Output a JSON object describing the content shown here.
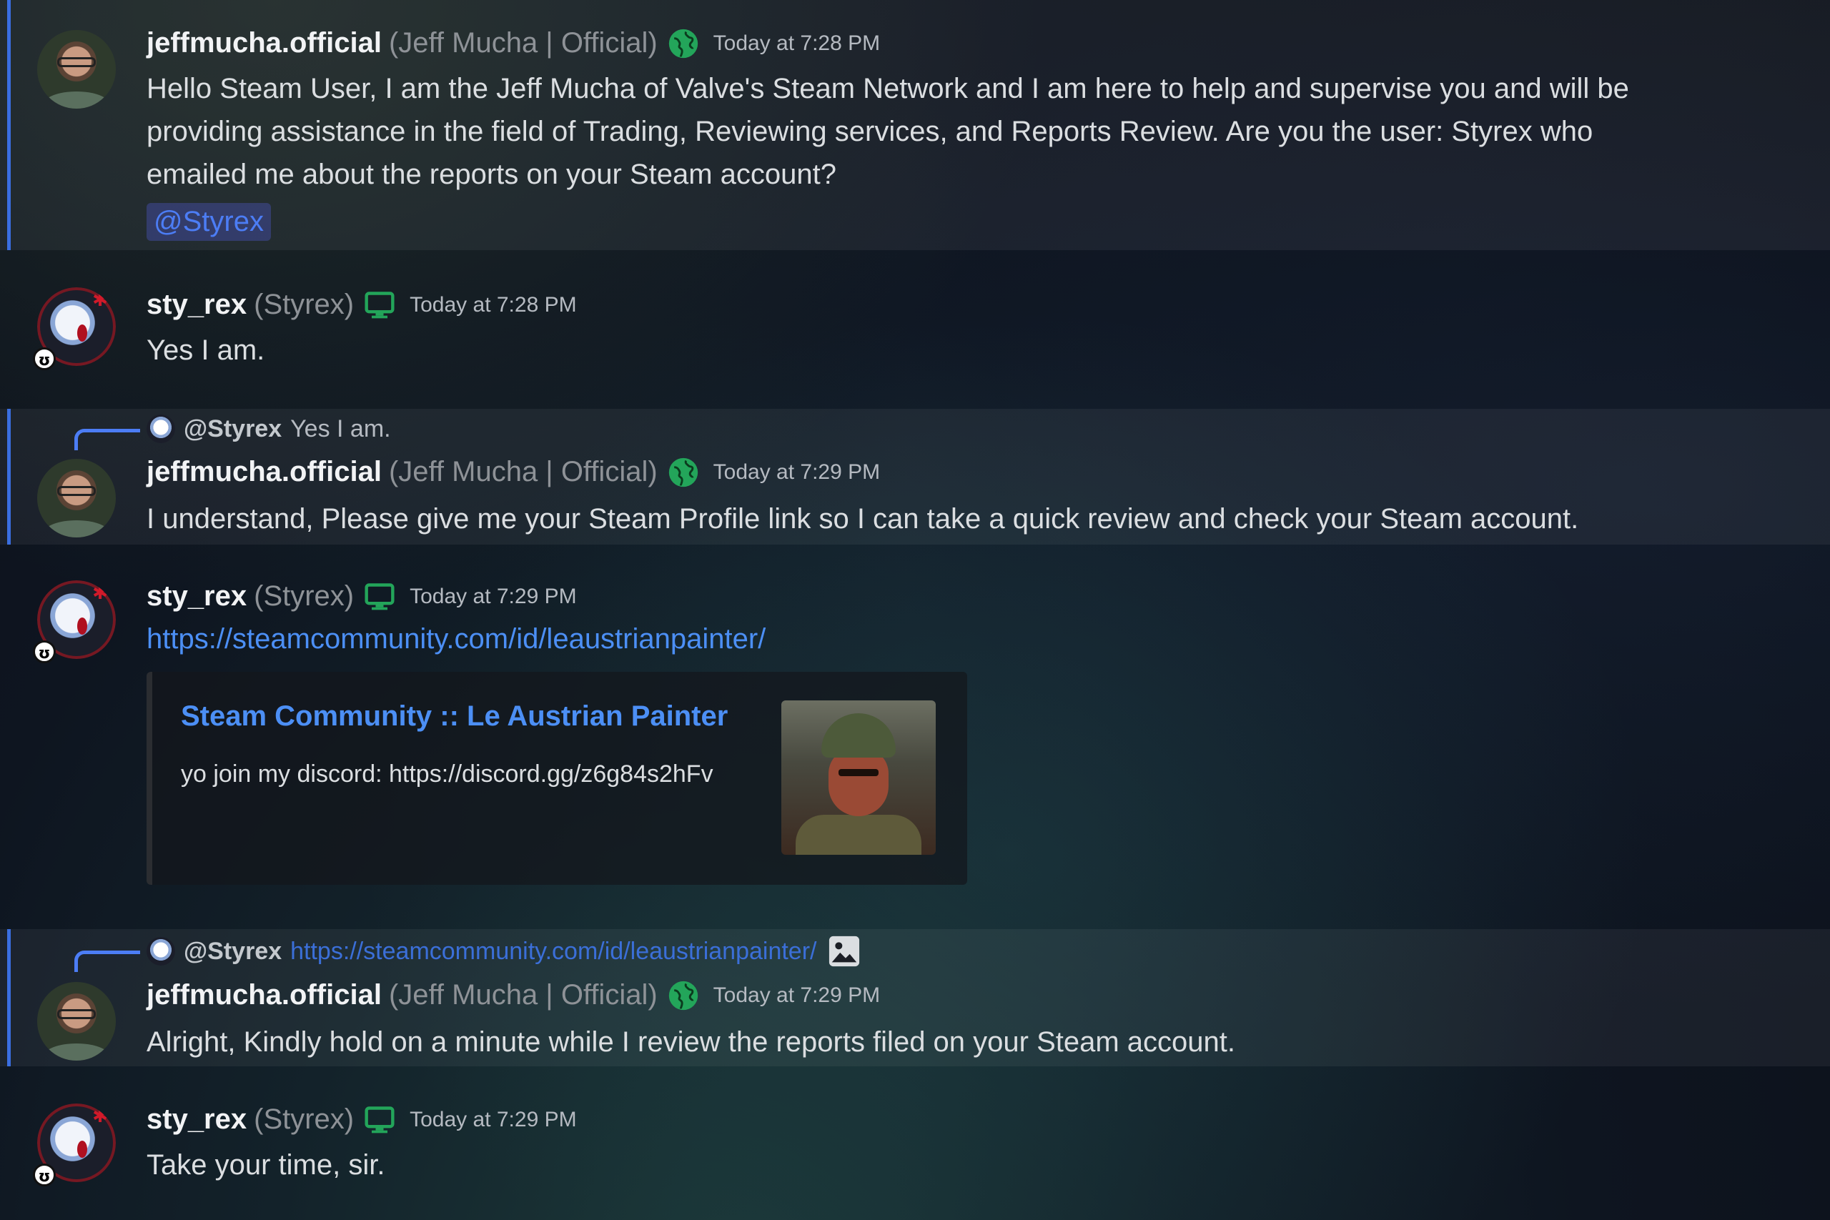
{
  "colors": {
    "accent_blue": "#4c7df5",
    "link_blue": "#4c8ff5",
    "status_green": "#23a55a",
    "username_white": "#f2f3f5",
    "nickname_gray": "#8e9297"
  },
  "messages": [
    {
      "username": "jeffmucha.official",
      "nickname": "(Jeff Mucha | Official)",
      "status_icon": "globe-icon",
      "timestamp": "Today at 7:28 PM",
      "lines": [
        "Hello Steam User, I am the Jeff Mucha of Valve's Steam Network and I am here to help and supervise you and will be",
        "providing assistance in the field of Trading, Reviewing services, and Reports Review. Are you the user: Styrex who",
        "emailed me about the reports on your Steam account?"
      ],
      "mention": "@Styrex"
    },
    {
      "username": "sty_rex",
      "nickname": "(Styrex)",
      "status_icon": "desktop-icon",
      "timestamp": "Today at 7:28 PM",
      "text": "Yes I am."
    },
    {
      "reply_user": "@Styrex",
      "reply_text": "Yes I am.",
      "username": "jeffmucha.official",
      "nickname": "(Jeff Mucha | Official)",
      "status_icon": "globe-icon",
      "timestamp": "Today at 7:29 PM",
      "text": "I understand, Please give me your Steam Profile link so I can take a quick review and check your Steam account."
    },
    {
      "username": "sty_rex",
      "nickname": "(Styrex)",
      "status_icon": "desktop-icon",
      "timestamp": "Today at 7:29 PM",
      "link": "https://steamcommunity.com/id/leaustrianpainter/",
      "embed": {
        "title": "Steam Community :: Le Austrian Painter",
        "description": "yo join my discord: https://discord.gg/z6g84s2hFv",
        "thumbnail": "soldier-portrait"
      }
    },
    {
      "reply_user": "@Styrex",
      "reply_text": "https://steamcommunity.com/id/leaustrianpainter/",
      "reply_icon": "image-icon",
      "username": "jeffmucha.official",
      "nickname": "(Jeff Mucha | Official)",
      "status_icon": "globe-icon",
      "timestamp": "Today at 7:29 PM",
      "text": "Alright, Kindly hold on a minute while I review the reports filed on your Steam account."
    },
    {
      "username": "sty_rex",
      "nickname": "(Styrex)",
      "status_icon": "desktop-icon",
      "timestamp": "Today at 7:29 PM",
      "text": "Take your time, sir."
    }
  ]
}
